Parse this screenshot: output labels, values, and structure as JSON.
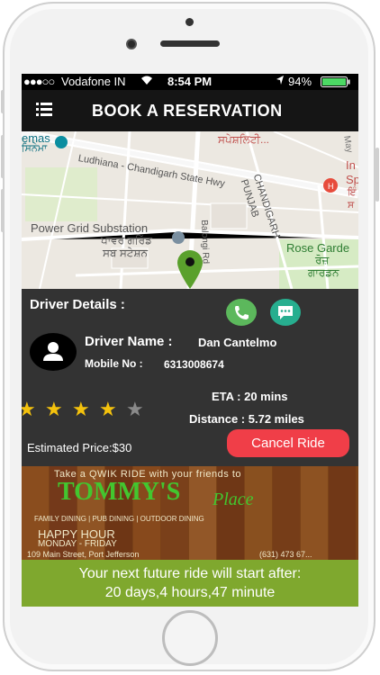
{
  "status_bar": {
    "carrier": "Vodafone IN",
    "time": "8:54 PM",
    "battery": "94%"
  },
  "app_bar": {
    "title": "BOOK A RESERVATION",
    "menu_icon": "hamburger-menu-icon"
  },
  "map": {
    "labels": {
      "top_left": "emas",
      "top_left_sub": "ਸਿਨੇਮਾ",
      "top_right_punjabi": "ਸਪੇਸ਼ਲਿਟੀ...",
      "highway": "Ludhiana - Chandigarh State Hwy",
      "chandigarh": "CHANDIGARH",
      "punjab": "PUNJAB",
      "substation": "Power Grid Substation",
      "substation_p1": "ਪਾਵਰ ਗਰਿੱਡ",
      "substation_p2": "ਸਬ ਸਟੇਸ਼ਨ",
      "balongi": "Balongi Rd",
      "rose_garden": "Rose Garde",
      "rose_p1": "ਰੋਜ਼",
      "rose_p2": "ਗਾਰਡਨ",
      "right_in": "In",
      "right_sp": "Sp",
      "right_p1": "ਇੰ",
      "right_p2": "ਸ",
      "may": "May"
    }
  },
  "driver_panel": {
    "header": "Driver Details :",
    "driver_name_label": "Driver Name :",
    "driver_name": "Dan Cantelmo",
    "mobile_label": "Mobile No :",
    "mobile": "6313008674",
    "rating": 4,
    "rating_max": 5,
    "eta": "ETA : 20 mins",
    "distance": "Distance : 5.72 miles",
    "estimated_price": "Estimated Price:$30",
    "cancel_label": "Cancel Ride",
    "call_icon": "phone-call-icon",
    "message_icon": "chat-message-icon"
  },
  "ad": {
    "tagline": "Take a QWIK RIDE with your friends to",
    "name": "TOMMY'S",
    "name_sub": "Place",
    "services": "FAMILY DINING | PUB DINING | OUTDOOR DINING",
    "happy_hour": "HAPPY HOUR",
    "days": "MONDAY - FRIDAY",
    "address": "109 Main Street, Port Jefferson",
    "phone": "(631) 473 67..."
  },
  "next_ride": {
    "line1": "Your next future ride will start after:",
    "line2": "20 days,4 hours,47 minute"
  },
  "colors": {
    "cancel": "#f03e48",
    "call": "#5cb85c",
    "chat": "#27ae8f",
    "banner": "#7fa82e",
    "panel": "#333333"
  }
}
